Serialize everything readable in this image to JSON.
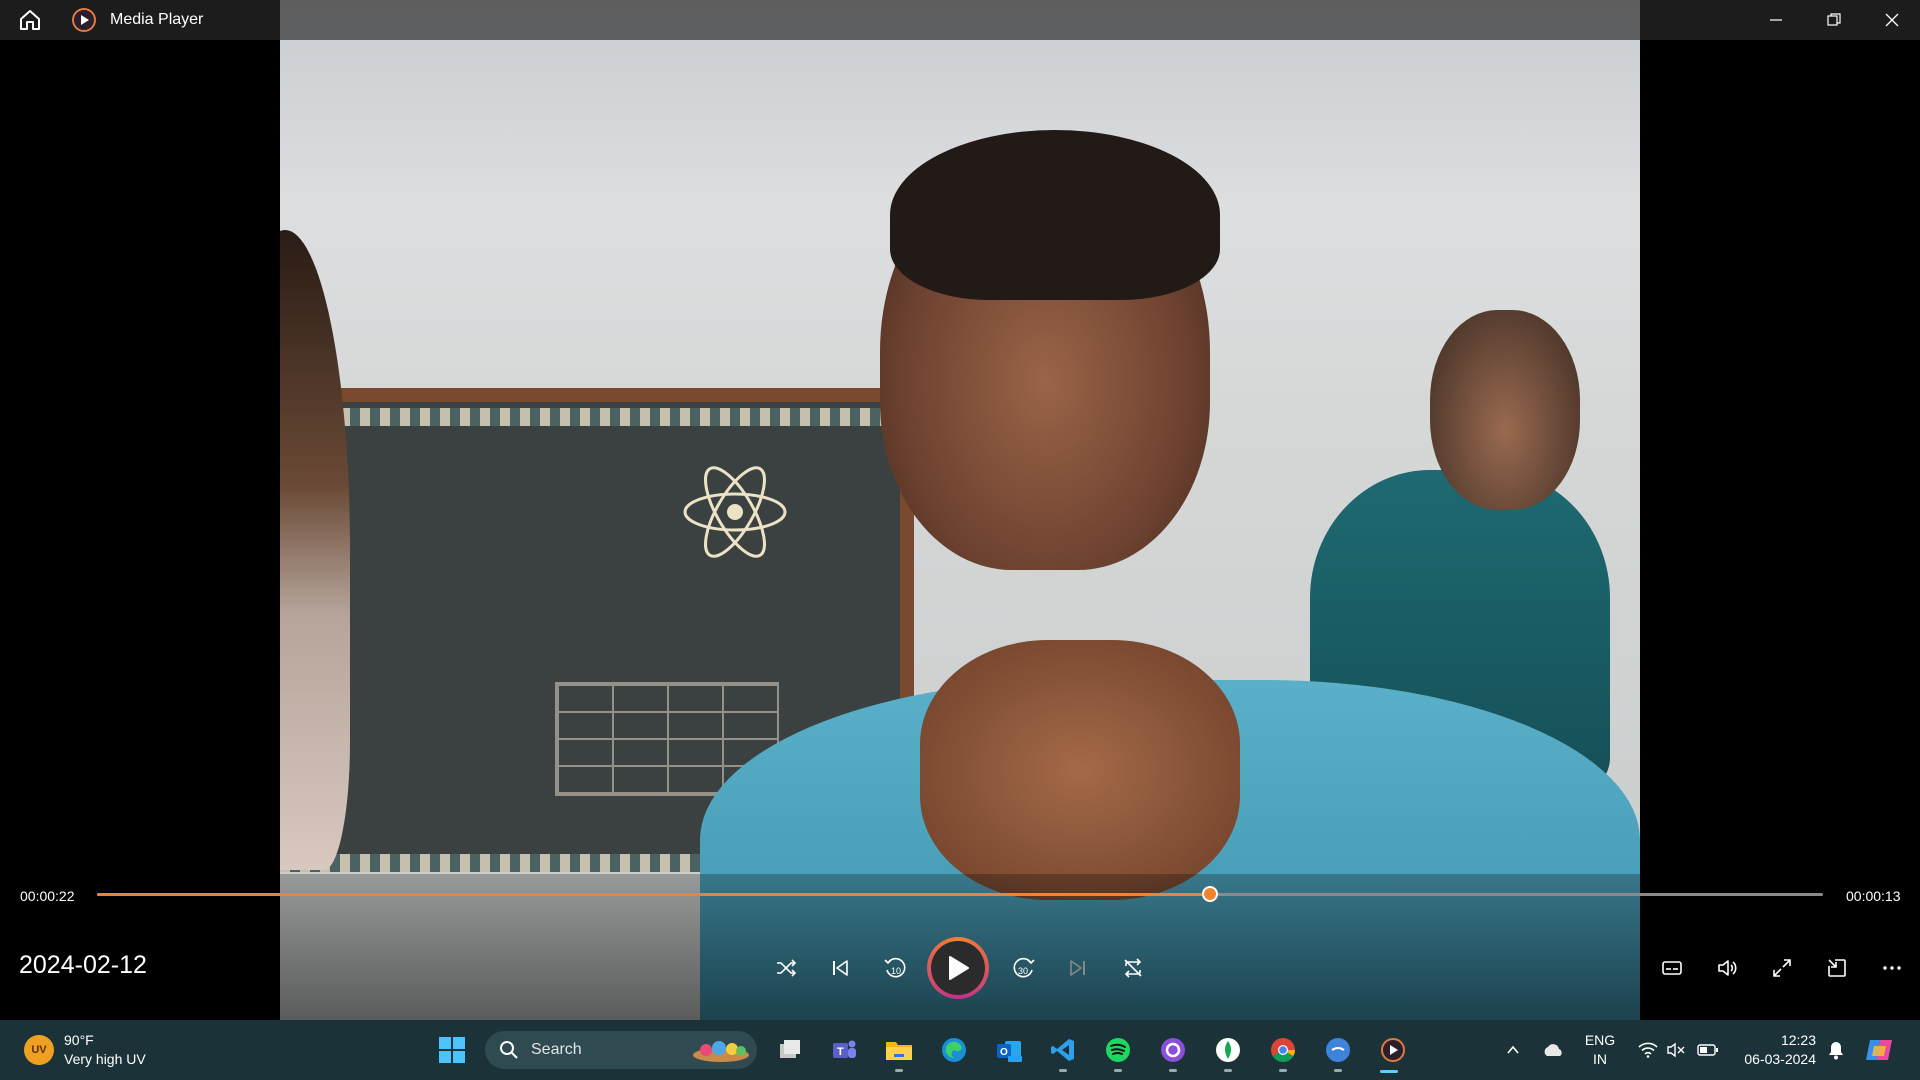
{
  "titlebar": {
    "app_title": "Media Player",
    "icons": [
      "home-icon",
      "media-player-icon",
      "minimize-icon",
      "restore-icon",
      "close-icon"
    ]
  },
  "player": {
    "media_title": "2024-02-12",
    "elapsed_time": "00:00:22",
    "remaining_time": "00:00:13",
    "progress": 0.645,
    "accent_color": "#f08230",
    "controls": [
      "shuffle-icon",
      "previous-icon",
      "rewind-10-icon",
      "play-icon",
      "forward-30-icon",
      "next-icon",
      "repeat-icon"
    ],
    "skip_back_seconds": "10",
    "skip_forward_seconds": "30",
    "right_controls": [
      "subtitles-icon",
      "volume-icon",
      "fullscreen-icon",
      "miniplayer-icon",
      "more-icon"
    ]
  },
  "taskbar": {
    "weather": {
      "badge": "UV",
      "temp": "90°F",
      "desc": "Very high UV"
    },
    "search_label": "Search",
    "apps": [
      "windows-start-icon",
      "task-view-icon",
      "teams-icon",
      "file-explorer-icon",
      "edge-icon",
      "outlook-icon",
      "vscode-icon",
      "spotify-icon",
      "github-icon",
      "mongodb-icon",
      "chrome-icon",
      "canva-icon",
      "media-player-icon"
    ],
    "tray": {
      "language": "ENG",
      "region": "IN",
      "time": "12:23",
      "date": "06-03-2024"
    }
  }
}
